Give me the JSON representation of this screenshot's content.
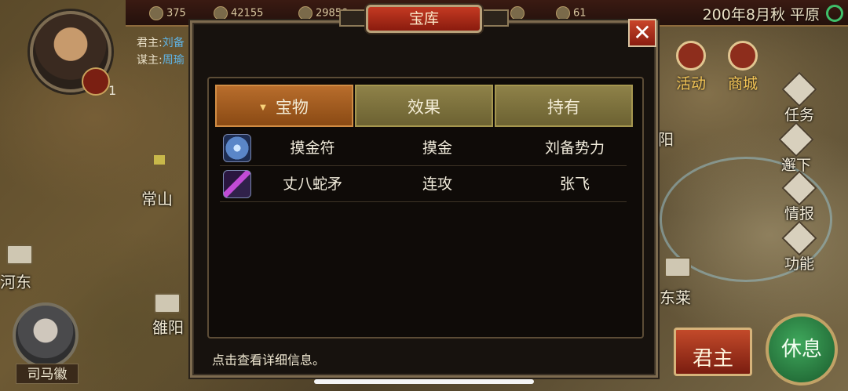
{
  "topbar": {
    "resources": [
      "375",
      "42155",
      "29850",
      "",
      "61"
    ],
    "date_location": "200年8月秋 平原"
  },
  "lord": {
    "badge_count": "1",
    "lord_label": "君主:",
    "lord_name": "刘备",
    "advisor_label": "谋主:",
    "advisor_name": "周瑜"
  },
  "map": {
    "cities": [
      "常山",
      "河东",
      "雒阳",
      "东莱",
      "阳"
    ]
  },
  "advisor_portrait": {
    "name": "司马徽"
  },
  "top_buttons": [
    "活动",
    "商城"
  ],
  "side_buttons": [
    "任务",
    "邂下",
    "情报",
    "功能"
  ],
  "bottom_buttons": {
    "lord": "君主",
    "rest": "休息"
  },
  "dialog": {
    "title": "宝库",
    "close_glyph": "✕",
    "tabs": [
      {
        "label": "宝物",
        "active": true
      },
      {
        "label": "效果",
        "active": false
      },
      {
        "label": "持有",
        "active": false
      }
    ],
    "rows": [
      {
        "icon": "talisman-icon",
        "name": "摸金符",
        "effect": "摸金",
        "owner": "刘备势力"
      },
      {
        "icon": "spear-icon",
        "name": "丈八蛇矛",
        "effect": "连攻",
        "owner": "张飞"
      }
    ],
    "hint": "点击查看详细信息。"
  }
}
